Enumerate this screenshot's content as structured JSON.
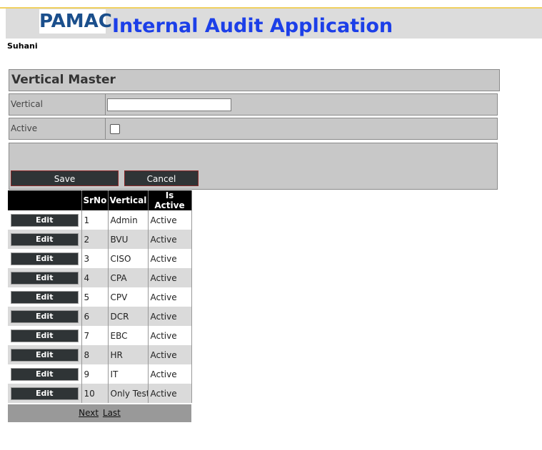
{
  "header": {
    "logo_text": "PAMAC",
    "app_title": "Internal Audit Application",
    "username": "Suhani"
  },
  "form": {
    "title": "Vertical Master",
    "vertical_label": "Vertical",
    "vertical_value": "",
    "active_label": "Active",
    "active_checked": false,
    "save_label": "Save",
    "cancel_label": "Cancel"
  },
  "grid": {
    "columns": [
      "",
      "SrNo",
      "Vertical",
      "Is Active"
    ],
    "edit_label": "Edit",
    "rows": [
      {
        "srno": "1",
        "vertical": "Admin",
        "status": "Active"
      },
      {
        "srno": "2",
        "vertical": "BVU",
        "status": "Active"
      },
      {
        "srno": "3",
        "vertical": "CISO",
        "status": "Active"
      },
      {
        "srno": "4",
        "vertical": "CPA",
        "status": "Active"
      },
      {
        "srno": "5",
        "vertical": "CPV",
        "status": "Active"
      },
      {
        "srno": "6",
        "vertical": "DCR",
        "status": "Active"
      },
      {
        "srno": "7",
        "vertical": "EBC",
        "status": "Active"
      },
      {
        "srno": "8",
        "vertical": "HR",
        "status": "Active"
      },
      {
        "srno": "9",
        "vertical": "IT",
        "status": "Active"
      },
      {
        "srno": "10",
        "vertical": "Only Test",
        "status": "Active"
      }
    ],
    "pager": {
      "next": "Next",
      "last": "Last"
    }
  },
  "colors": {
    "title_blue": "#1c3fe8",
    "logo_blue": "#1b4f8c",
    "button_dark": "#2f3436",
    "panel_gray": "#c8c8c8"
  }
}
